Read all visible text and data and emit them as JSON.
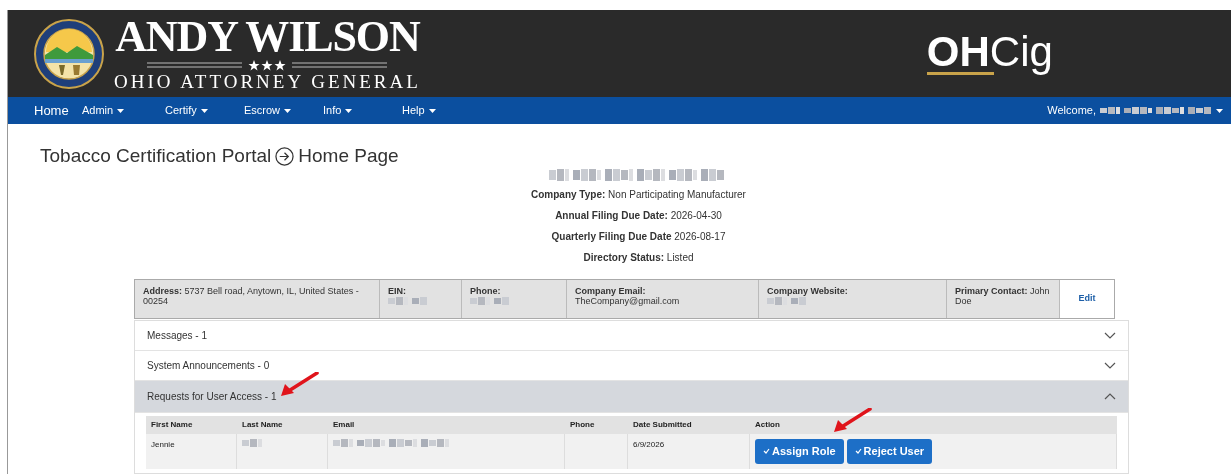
{
  "header": {
    "name": "ANDY WILSON",
    "subtitle": "OHIO ATTORNEY GENERAL",
    "app_logo": {
      "bold": "OH",
      "light": "Cig"
    }
  },
  "nav": {
    "items": [
      {
        "label": "Home",
        "dropdown": false
      },
      {
        "label": "Admin",
        "dropdown": true
      },
      {
        "label": "Certify",
        "dropdown": true
      },
      {
        "label": "Escrow",
        "dropdown": true
      },
      {
        "label": "Info",
        "dropdown": true
      },
      {
        "label": "Help",
        "dropdown": true
      }
    ],
    "welcome": "Welcome,",
    "user": {
      "kind": "blurred",
      "dropdown": true
    }
  },
  "page_title": {
    "left": "Tobacco Certification Portal",
    "right": "Home Page"
  },
  "company": {
    "name": {
      "kind": "blurred"
    },
    "fields": [
      {
        "label": "Company Type:",
        "value": "Non Participating Manufacturer"
      },
      {
        "label": "Annual Filing Due Date:",
        "value": "2026-04-30"
      },
      {
        "label": "Quarterly Filing Due Date",
        "value": "2026-08-17"
      },
      {
        "label": "Directory Status:",
        "value": "Listed"
      }
    ]
  },
  "info_bar": {
    "cells": [
      {
        "label": "Address:",
        "kind": "text",
        "value": "5737 Bell road, Anytown, IL, United States - 00254"
      },
      {
        "label": "EIN:",
        "kind": "blurred"
      },
      {
        "label": "Phone:",
        "kind": "blurred"
      },
      {
        "label": "Company Email:",
        "kind": "text",
        "value": "TheCompany@gmail.com"
      },
      {
        "label": "Company Website:",
        "kind": "blurred"
      },
      {
        "label": "Primary Contact:",
        "kind": "text",
        "value": "John Doe"
      }
    ],
    "edit_button": "Edit"
  },
  "accordion": [
    {
      "title": "Messages - 1",
      "expanded": false,
      "annotation_arrow": false
    },
    {
      "title": "System Announcements - 0",
      "expanded": false,
      "annotation_arrow": false
    },
    {
      "title": "Requests for User Access - 1",
      "expanded": true,
      "annotation_arrow": true,
      "table": {
        "columns": [
          {
            "label": "First Name",
            "annotation_arrow": false
          },
          {
            "label": "Last Name",
            "annotation_arrow": false
          },
          {
            "label": "Email",
            "annotation_arrow": false
          },
          {
            "label": "Phone",
            "annotation_arrow": false
          },
          {
            "label": "Date Submitted",
            "annotation_arrow": false
          },
          {
            "label": "Action",
            "annotation_arrow": true
          }
        ],
        "rows": [
          {
            "cells": [
              {
                "kind": "text",
                "text": "Jennie"
              },
              {
                "kind": "blurred"
              },
              {
                "kind": "blurred"
              },
              {
                "kind": "empty"
              },
              {
                "kind": "text",
                "text": "6/9/2026"
              },
              {
                "kind": "actions",
                "buttons": [
                  "Assign Role",
                  "Reject User"
                ]
              }
            ]
          }
        ]
      }
    }
  ]
}
